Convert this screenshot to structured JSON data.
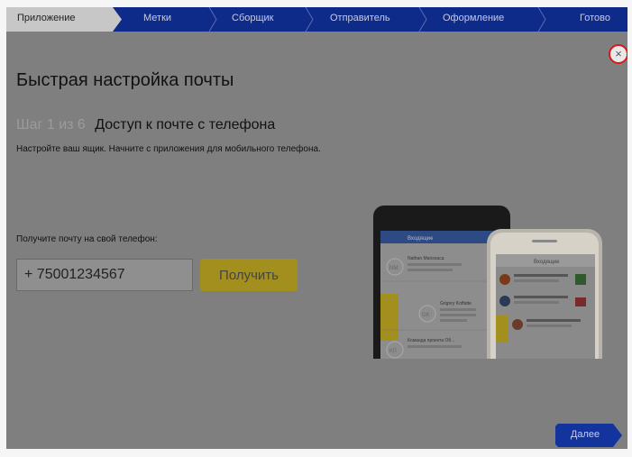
{
  "wizard": {
    "steps": [
      {
        "label": "Приложение",
        "active": true
      },
      {
        "label": "Метки",
        "active": false
      },
      {
        "label": "Сборщик",
        "active": false
      },
      {
        "label": "Отправитель",
        "active": false
      },
      {
        "label": "Оформление",
        "active": false
      },
      {
        "label": "Готово",
        "active": false
      }
    ]
  },
  "dialog": {
    "close_symbol": "×",
    "title": "Быстрая настройка почты",
    "step_counter": "Шаг 1 из 6",
    "step_heading": "Доступ к почте с телефона",
    "subtitle": "Настройте ваш ящик. Начните с приложения для мобильного телефона.",
    "phone_label": "Получите почту на свой телефон:",
    "phone_value": "+ 75001234567",
    "get_button": "Получить",
    "next_button": "Далее"
  },
  "preview": {
    "android_header": "Входящие",
    "android_items": [
      {
        "avatar": "NM",
        "text": "Nathan Mansouca"
      },
      {
        "avatar": "GK",
        "text": "Grigory Koffatte"
      },
      {
        "avatar": "КП",
        "text": "Команда проекта Об..."
      }
    ],
    "iphone_header": "Входящие"
  },
  "colors": {
    "stepbar_active": "#c7c7c7",
    "stepbar_inactive": "#0e2b8a",
    "accent_yellow": "#a38f1e",
    "close_ring": "#d61a1a",
    "next_button": "#13349c"
  }
}
